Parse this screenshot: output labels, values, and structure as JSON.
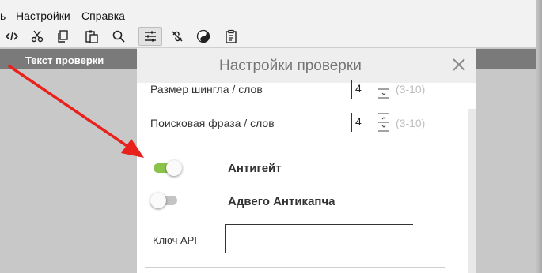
{
  "menubar": {
    "items": [
      "ь",
      "Настройки",
      "Справка"
    ]
  },
  "toolbar": {
    "icons": [
      "code-icon",
      "scissors-icon",
      "copy-icon",
      "paste-icon",
      "search-icon",
      "sliders-icon",
      "unlink-icon",
      "yin-yang-icon",
      "clipboard-icon"
    ],
    "active": "sliders-icon"
  },
  "panel": {
    "title": "Текст проверки"
  },
  "dialog": {
    "title": "Настройки проверки",
    "shingle": {
      "label": "Размер шингла / слов",
      "value": "4",
      "range": "(3-10)"
    },
    "phrase": {
      "label": "Поисковая фраза / слов",
      "value": "4",
      "range": "(3-10)"
    },
    "antigate": {
      "label": "Антигейт",
      "on": true
    },
    "advego": {
      "label": "Адвего Антикапча",
      "on": false
    },
    "api": {
      "label": "Ключ API",
      "value": ""
    }
  },
  "colors": {
    "toggle_on_track": "#8bc34a",
    "toggle_off_track": "#bdbdbd",
    "arrow": "#e8211c",
    "header_gray": "#7a7a7a",
    "dialog_title": "#757575"
  }
}
